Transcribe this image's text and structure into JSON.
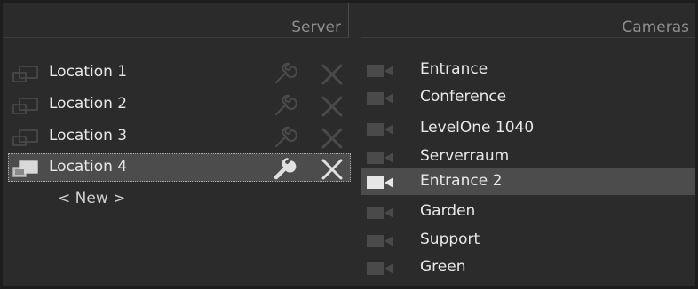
{
  "server": {
    "title": "Server",
    "locations": [
      {
        "label": "Location 1",
        "selected": false
      },
      {
        "label": "Location 2",
        "selected": false
      },
      {
        "label": "Location 3",
        "selected": false
      },
      {
        "label": "Location 4",
        "selected": true
      }
    ],
    "new_label": "< New >",
    "icons": {
      "location": "computer-icon",
      "edit": "wrench-icon",
      "delete": "close-icon"
    }
  },
  "cameras": {
    "title": "Cameras",
    "items": [
      {
        "label": "Entrance",
        "selected": false
      },
      {
        "label": "Conference",
        "selected": false
      },
      {
        "label": "LevelOne 1040",
        "selected": false
      },
      {
        "label": "Serverraum",
        "selected": false
      },
      {
        "label": "Entrance 2",
        "selected": true
      },
      {
        "label": "Garden",
        "selected": false
      },
      {
        "label": "Support",
        "selected": false
      },
      {
        "label": "Green",
        "selected": false
      }
    ],
    "icon": "camera-icon"
  },
  "colors": {
    "background": "#2b2b2b",
    "selection": "#4c4c4c",
    "text": "#e8e8e8",
    "header_text": "#8e8e8e",
    "icon_dim": "#4a4a4a",
    "icon_active": "#e0e0e0"
  }
}
